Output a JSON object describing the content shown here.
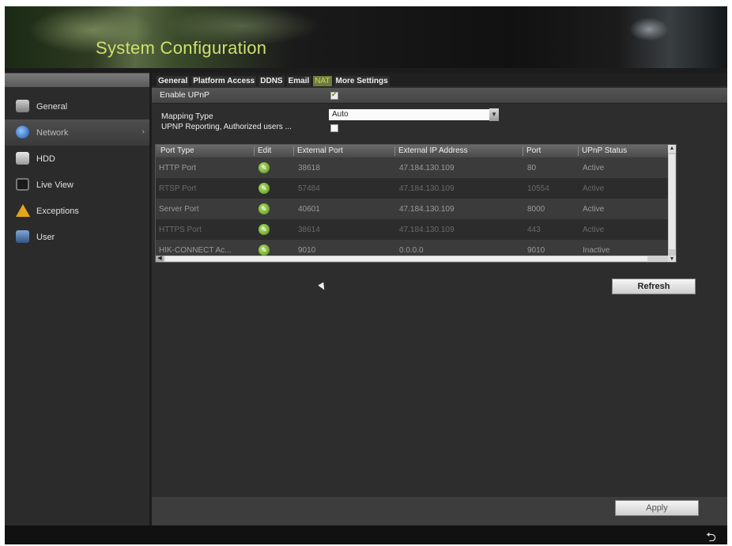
{
  "header": {
    "title": "System Configuration"
  },
  "sidebar": {
    "items": [
      {
        "label": "General",
        "icon": "general-icon"
      },
      {
        "label": "Network",
        "icon": "network-icon",
        "active": true
      },
      {
        "label": "HDD",
        "icon": "hdd-icon"
      },
      {
        "label": "Live View",
        "icon": "live-view-icon"
      },
      {
        "label": "Exceptions",
        "icon": "warning-icon"
      },
      {
        "label": "User",
        "icon": "user-icon"
      }
    ]
  },
  "tabs": [
    {
      "label": "General"
    },
    {
      "label": "Platform Access"
    },
    {
      "label": "DDNS"
    },
    {
      "label": "Email"
    },
    {
      "label": "NAT",
      "active": true
    },
    {
      "label": "More Settings"
    }
  ],
  "form": {
    "enable_upnp_label": "Enable UPnP",
    "enable_upnp_checked": true,
    "mapping_type_label": "Mapping Type",
    "mapping_type_value": "Auto",
    "reporting_label": "UPNP Reporting, Authorized users ...",
    "reporting_checked": false
  },
  "table": {
    "columns": [
      "Port Type",
      "Edit",
      "External Port",
      "External IP Address",
      "Port",
      "UPnP Status"
    ],
    "rows": [
      {
        "type": "HTTP Port",
        "ext_port": "38618",
        "ext_ip": "47.184.130.109",
        "port": "80",
        "status": "Active"
      },
      {
        "type": "RTSP Port",
        "ext_port": "57484",
        "ext_ip": "47.184.130.109",
        "port": "10554",
        "status": "Active"
      },
      {
        "type": "Server Port",
        "ext_port": "40601",
        "ext_ip": "47.184.130.109",
        "port": "8000",
        "status": "Active"
      },
      {
        "type": "HTTPS Port",
        "ext_port": "38614",
        "ext_ip": "47.184.130.109",
        "port": "443",
        "status": "Active"
      },
      {
        "type": "HIK-CONNECT Ac...",
        "ext_port": "9010",
        "ext_ip": "0.0.0.0",
        "port": "9010",
        "status": "Inactive"
      }
    ]
  },
  "buttons": {
    "refresh": "Refresh",
    "apply": "Apply"
  },
  "colors": {
    "title": "#cfe06c",
    "active_tab": "#6d7a3a",
    "edit_icon": "#7cc22e"
  }
}
